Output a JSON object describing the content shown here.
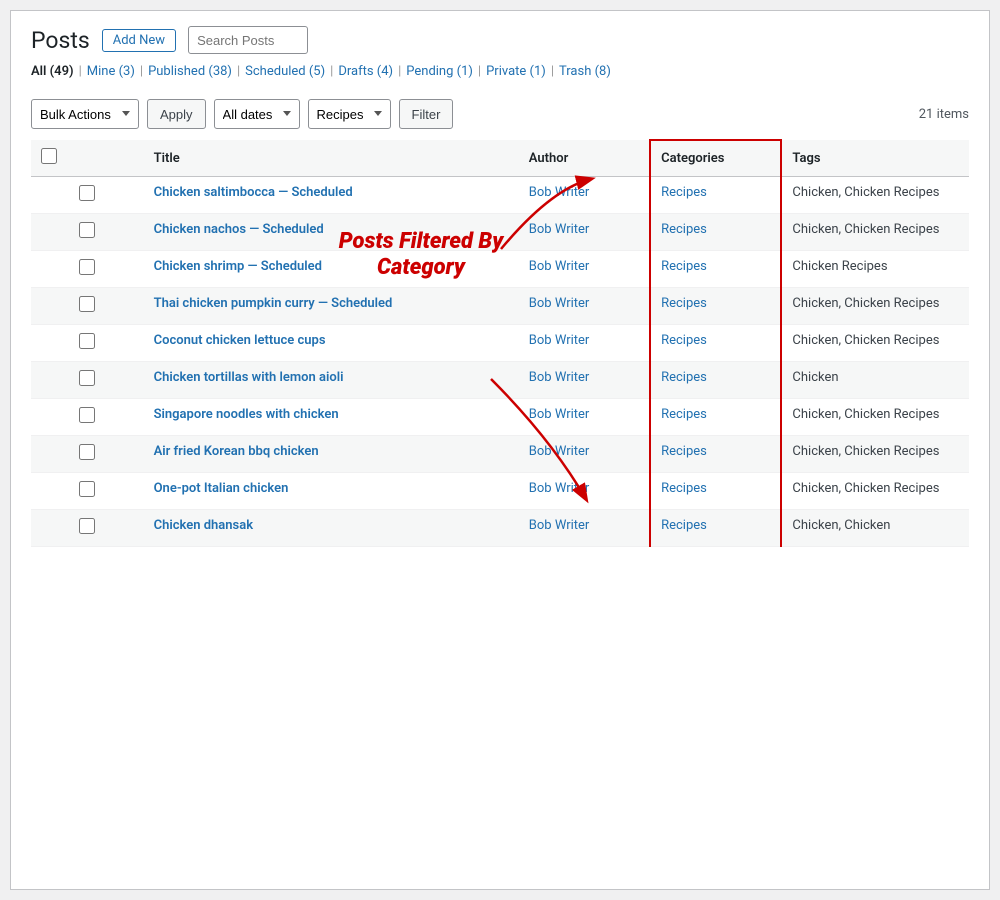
{
  "page": {
    "title": "Posts",
    "add_new_label": "Add New"
  },
  "filter_links": [
    {
      "label": "All",
      "count": 49,
      "href": "#",
      "current": true
    },
    {
      "label": "Mine",
      "count": 3,
      "href": "#",
      "current": false
    },
    {
      "label": "Published",
      "count": 38,
      "href": "#",
      "current": false
    },
    {
      "label": "Scheduled",
      "count": 5,
      "href": "#",
      "current": false
    },
    {
      "label": "Drafts",
      "count": 4,
      "href": "#",
      "current": false
    },
    {
      "label": "Pending",
      "count": 1,
      "href": "#",
      "current": false
    },
    {
      "label": "Private",
      "count": 1,
      "href": "#",
      "current": false
    },
    {
      "label": "Trash",
      "count": 8,
      "href": "#",
      "current": false
    }
  ],
  "toolbar": {
    "bulk_actions_label": "Bulk Actions",
    "apply_label": "Apply",
    "filter_label": "Filter",
    "items_count": "21 items",
    "dates_options": [
      "All dates"
    ],
    "dates_selected": "All dates",
    "category_options": [
      "Recipes"
    ],
    "category_selected": "Recipes"
  },
  "table": {
    "columns": [
      "",
      "Title",
      "Author",
      "Categories",
      "Tags"
    ],
    "rows": [
      {
        "title": "Chicken saltimbocca — Scheduled",
        "author": "Bob Writer",
        "categories": "Recipes",
        "tags": "Chicken, Chicken Recipes"
      },
      {
        "title": "Chicken nachos — Scheduled",
        "author": "Bob Writer",
        "categories": "Recipes",
        "tags": "Chicken, Chicken Recipes"
      },
      {
        "title": "Chicken shrimp — Scheduled",
        "author": "Bob Writer",
        "categories": "Recipes",
        "tags": "Chicken Recipes"
      },
      {
        "title": "Thai chicken pumpkin curry — Scheduled",
        "author": "Bob Writer",
        "categories": "Recipes",
        "tags": "Chicken, Chicken Recipes"
      },
      {
        "title": "Coconut chicken lettuce cups",
        "author": "Bob Writer",
        "categories": "Recipes",
        "tags": "Chicken, Chicken Recipes"
      },
      {
        "title": "Chicken tortillas with lemon aioli",
        "author": "Bob Writer",
        "categories": "Recipes",
        "tags": "Chicken"
      },
      {
        "title": "Singapore noodles with chicken",
        "author": "Bob Writer",
        "categories": "Recipes",
        "tags": "Chicken, Chicken Recipes"
      },
      {
        "title": "Air fried Korean bbq chicken",
        "author": "Bob Writer",
        "categories": "Recipes",
        "tags": "Chicken, Chicken Recipes"
      },
      {
        "title": "One-pot Italian chicken",
        "author": "Bob Writer",
        "categories": "Recipes",
        "tags": "Chicken, Chicken Recipes"
      },
      {
        "title": "Chicken dhansak",
        "author": "Bob Writer",
        "categories": "Recipes",
        "tags": "Chicken, Chicken"
      }
    ]
  },
  "annotation": {
    "text": "Posts Filtered By Category",
    "tag_label": "Chicken Recipes"
  }
}
